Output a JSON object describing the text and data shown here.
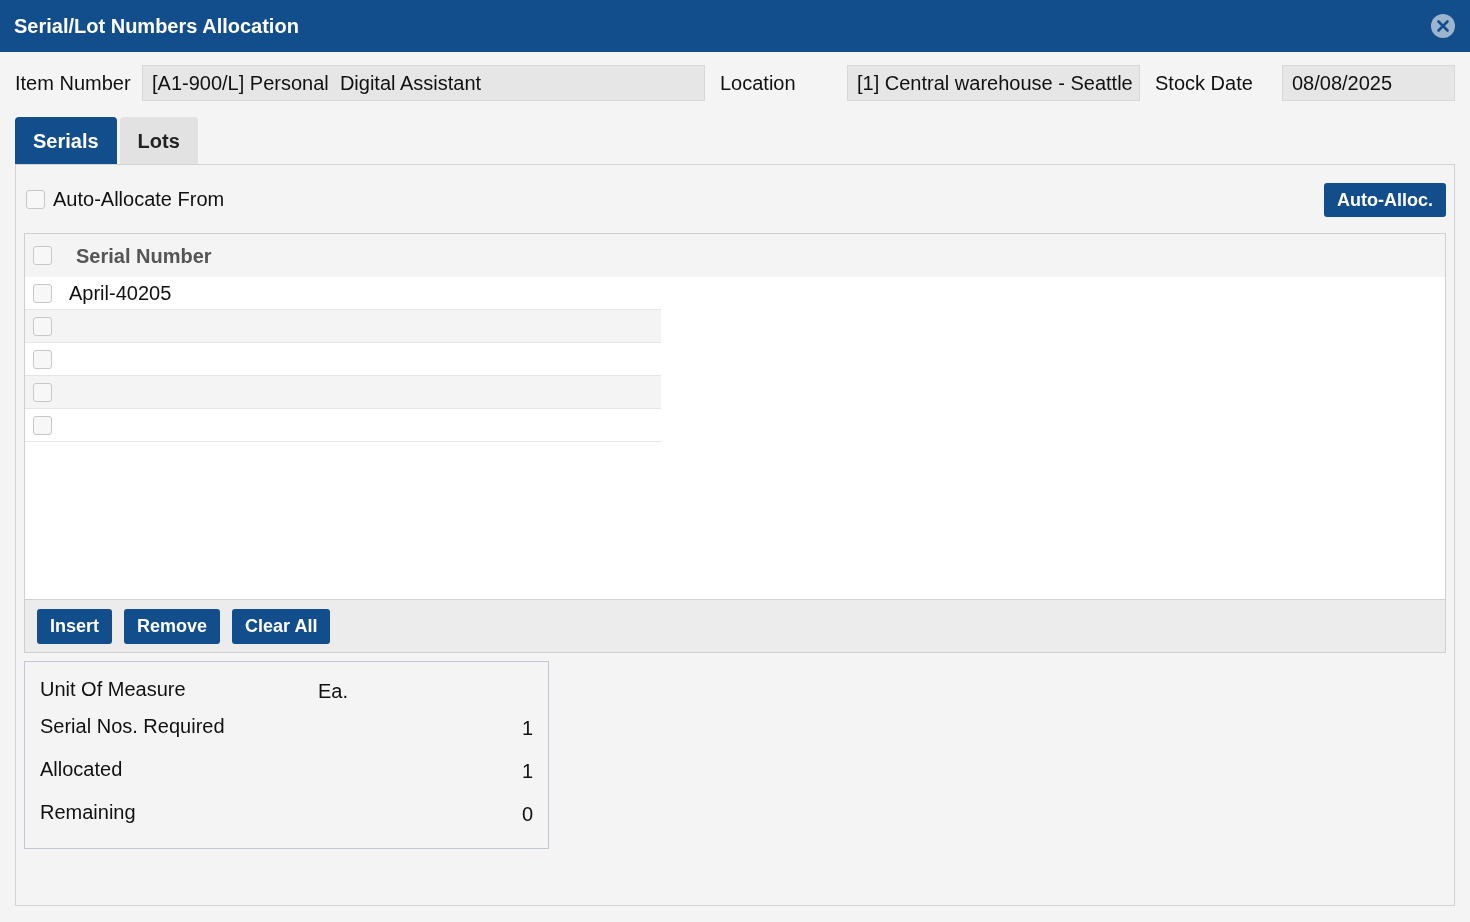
{
  "window": {
    "title": "Serial/Lot Numbers Allocation"
  },
  "header_fields": [
    {
      "label": "Item Number",
      "value": "[A1-900/L] Personal  Digital Assistant",
      "kind": "wide"
    },
    {
      "label": "Location",
      "value": "[1] Central warehouse - Seattle",
      "kind": "medium"
    },
    {
      "label": "Stock Date",
      "value": "08/08/2025",
      "kind": "narrow"
    }
  ],
  "tabs": [
    {
      "label": "Serials",
      "selected": true
    },
    {
      "label": "Lots",
      "selected": false
    }
  ],
  "auto_allocate": {
    "label": "Auto-Allocate From",
    "checked": false
  },
  "auto_alloc_button": "Auto-Alloc.",
  "grid": {
    "header_checked": false,
    "column": "Serial Number",
    "rows": [
      {
        "serial": "April-40205",
        "checked": false
      },
      {
        "serial": "",
        "checked": false
      },
      {
        "serial": "",
        "checked": false
      },
      {
        "serial": "",
        "checked": false
      },
      {
        "serial": "",
        "checked": false
      }
    ]
  },
  "grid_buttons": [
    "Insert",
    "Remove",
    "Clear All"
  ],
  "summary": [
    {
      "label": "Unit Of Measure",
      "value": "Ea.",
      "kind": "unit"
    },
    {
      "label": "Serial Nos. Required",
      "value": "1",
      "kind": "count"
    },
    {
      "label": "Allocated",
      "value": "1",
      "kind": "count"
    },
    {
      "label": "Remaining",
      "value": "0",
      "kind": "count"
    }
  ]
}
